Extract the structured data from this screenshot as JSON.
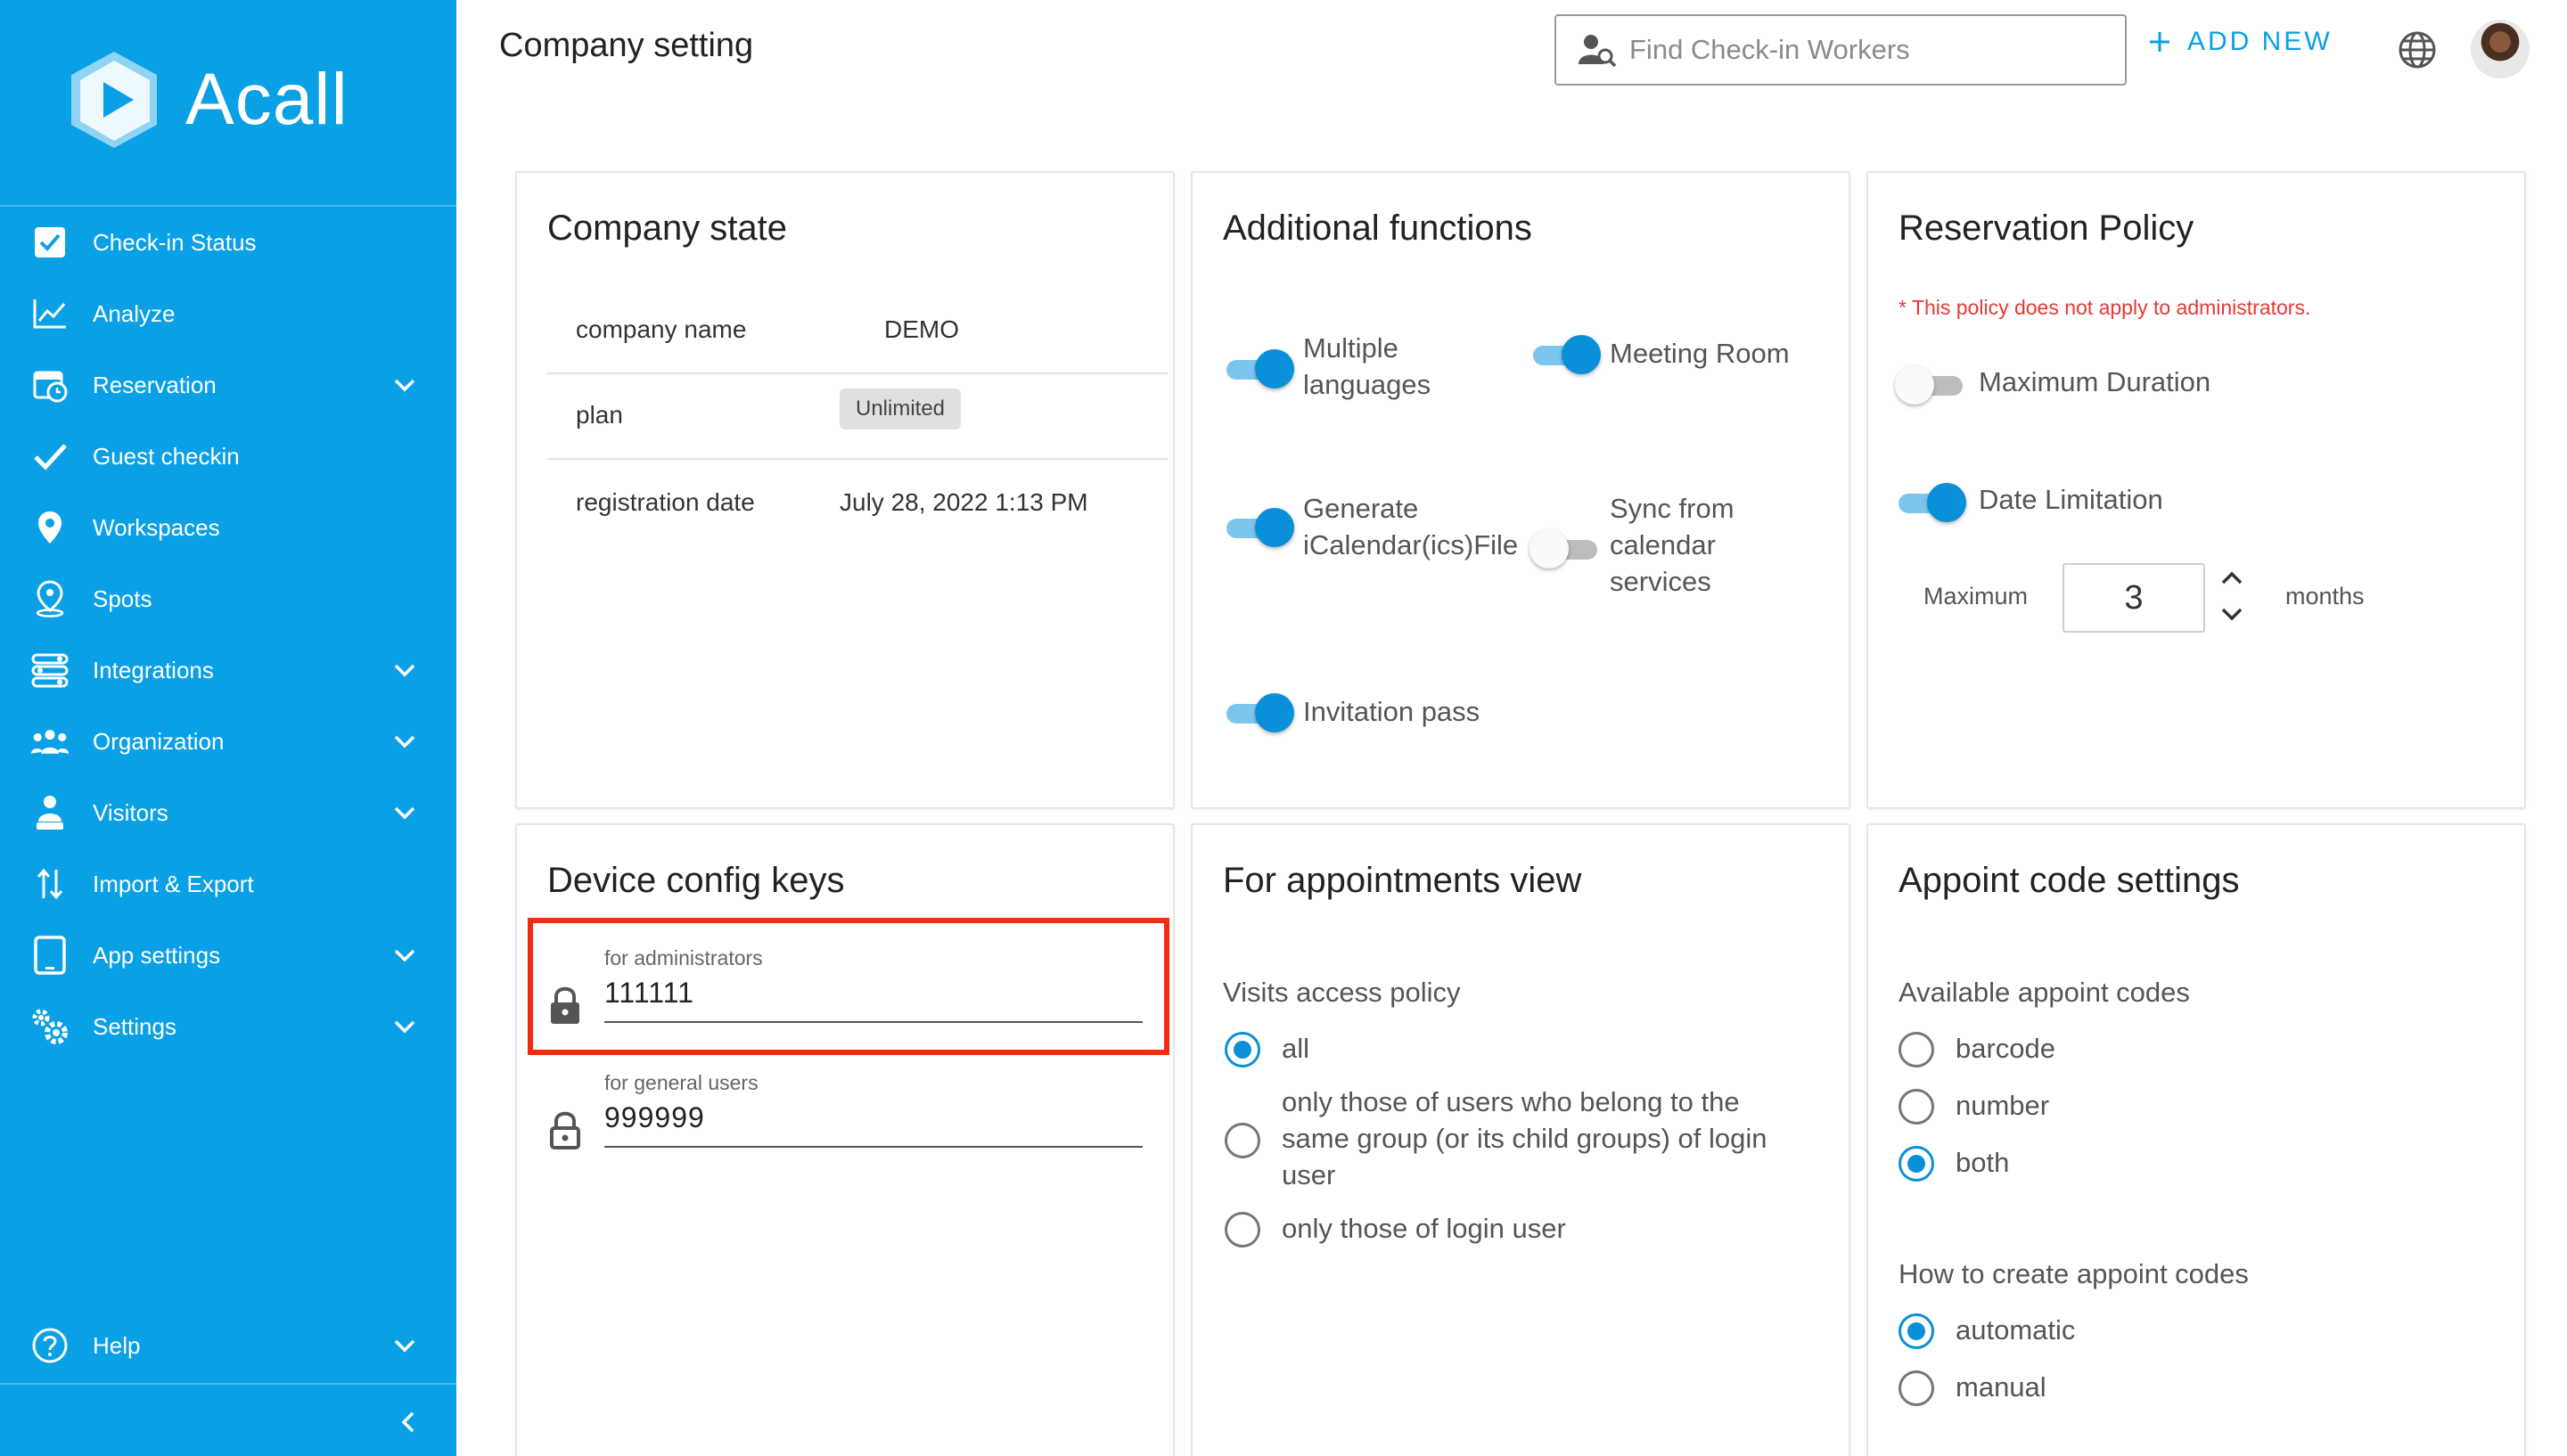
{
  "brand": {
    "name": "Acall"
  },
  "sidebar": {
    "items": [
      {
        "label": "Check-in Status",
        "icon": "checkbox-icon",
        "expandable": false
      },
      {
        "label": "Analyze",
        "icon": "chart-line-icon",
        "expandable": false
      },
      {
        "label": "Reservation",
        "icon": "calendar-clock-icon",
        "expandable": true
      },
      {
        "label": "Guest checkin",
        "icon": "checkmark-icon",
        "expandable": false
      },
      {
        "label": "Workspaces",
        "icon": "map-pin-icon",
        "expandable": false
      },
      {
        "label": "Spots",
        "icon": "person-pin-icon",
        "expandable": false
      },
      {
        "label": "Integrations",
        "icon": "integrations-icon",
        "expandable": true
      },
      {
        "label": "Organization",
        "icon": "people-group-icon",
        "expandable": true
      },
      {
        "label": "Visitors",
        "icon": "visitor-icon",
        "expandable": true
      },
      {
        "label": "Import & Export",
        "icon": "import-export-icon",
        "expandable": false
      },
      {
        "label": "App settings",
        "icon": "tablet-icon",
        "expandable": true
      },
      {
        "label": "Settings",
        "icon": "gears-icon",
        "expandable": true
      }
    ],
    "help": {
      "label": "Help",
      "icon": "help-icon",
      "expandable": true
    }
  },
  "header": {
    "title": "Company setting",
    "search_placeholder": "Find Check-in Workers",
    "add_new_label": "ADD NEW"
  },
  "company_state": {
    "title": "Company state",
    "rows": [
      {
        "key": "company name",
        "value": "DEMO"
      },
      {
        "key": "plan",
        "value": "Unlimited"
      },
      {
        "key": "registration date",
        "value": "July 28, 2022 1:13 PM"
      }
    ]
  },
  "additional_functions": {
    "title": "Additional functions",
    "toggles": [
      {
        "label": "Multiple languages",
        "lines": [
          "Multiple",
          "languages"
        ],
        "on": true
      },
      {
        "label": "Meeting Room",
        "lines": [
          "Meeting Room"
        ],
        "on": true
      },
      {
        "label": "Generate iCalendar(ics)File",
        "lines": [
          "Generate",
          "iCalendar(ics)File"
        ],
        "on": true
      },
      {
        "label": "Sync from calendar services",
        "lines": [
          "Sync from",
          "calendar",
          "services"
        ],
        "on": false
      },
      {
        "label": "Invitation pass",
        "lines": [
          "Invitation pass"
        ],
        "on": true
      }
    ]
  },
  "reservation_policy": {
    "title": "Reservation Policy",
    "note": "* This policy does not apply to administrators.",
    "max_duration_label": "Maximum Duration",
    "max_duration_on": false,
    "date_limitation_label": "Date Limitation",
    "date_limitation_on": true,
    "maximum_label": "Maximum",
    "maximum_value": "3",
    "unit_label": "months"
  },
  "device_config_keys": {
    "title": "Device config keys",
    "admin": {
      "label": "for administrators",
      "value": "111111"
    },
    "general": {
      "label": "for general users",
      "value": "999999"
    }
  },
  "appointments_view": {
    "title": "For appointments view",
    "policy_label": "Visits access policy",
    "options": [
      {
        "label": "all",
        "lines": [
          "all"
        ],
        "checked": true
      },
      {
        "label": "only those of users who belong to the same group (or its child groups) of login user",
        "lines": [
          "only those of users who belong to the",
          "same group (or its child groups) of login",
          "user"
        ],
        "checked": false
      },
      {
        "label": "only those of login user",
        "lines": [
          "only those of login user"
        ],
        "checked": false
      }
    ]
  },
  "appoint_code": {
    "title": "Appoint code settings",
    "available_label": "Available appoint codes",
    "available_options": [
      {
        "label": "barcode",
        "checked": false
      },
      {
        "label": "number",
        "checked": false
      },
      {
        "label": "both",
        "checked": true
      }
    ],
    "create_label": "How to create appoint codes",
    "create_options": [
      {
        "label": "automatic",
        "checked": true
      },
      {
        "label": "manual",
        "checked": false
      }
    ]
  },
  "colors": {
    "sidebar": "#0aa0e5",
    "accent": "#0a90d8",
    "highlight": "#f42b13",
    "note": "#e53935"
  }
}
